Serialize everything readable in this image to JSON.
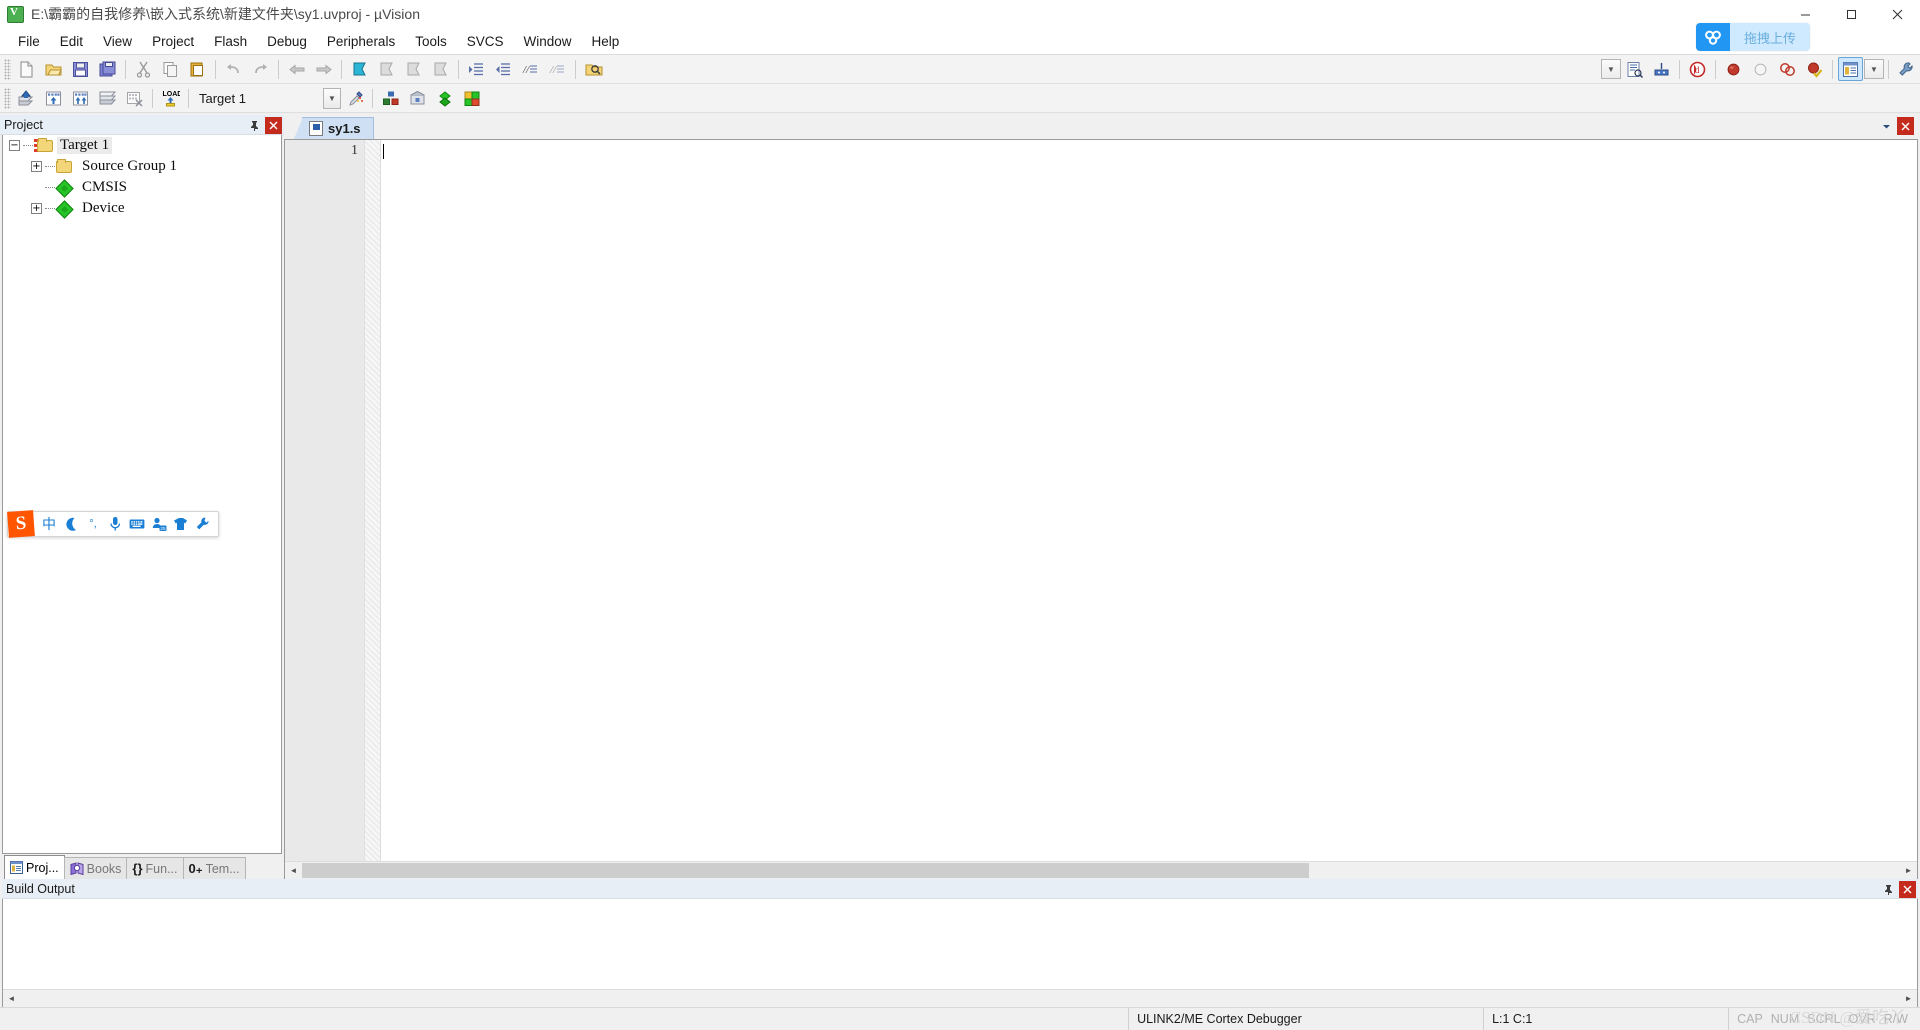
{
  "window": {
    "title": "E:\\霸霸的自我修养\\嵌入式系统\\新建文件夹\\sy1.uvproj - µVision",
    "app_icon": "uvision-icon",
    "minimize": "–",
    "maximize": "☐",
    "close": "✕"
  },
  "menu": {
    "items": [
      {
        "label": "File",
        "name": "menu-file"
      },
      {
        "label": "Edit",
        "name": "menu-edit"
      },
      {
        "label": "View",
        "name": "menu-view"
      },
      {
        "label": "Project",
        "name": "menu-project"
      },
      {
        "label": "Flash",
        "name": "menu-flash"
      },
      {
        "label": "Debug",
        "name": "menu-debug"
      },
      {
        "label": "Peripherals",
        "name": "menu-peripherals"
      },
      {
        "label": "Tools",
        "name": "menu-tools"
      },
      {
        "label": "SVCS",
        "name": "menu-svcs"
      },
      {
        "label": "Window",
        "name": "menu-window"
      },
      {
        "label": "Help",
        "name": "menu-help"
      }
    ]
  },
  "upload_widget": {
    "label": "拖拽上传",
    "icon": "baidu-netdisk-icon",
    "icon_color": "#2196f3",
    "label_bg": "#cfeaff",
    "label_color": "#6aaede"
  },
  "toolbar_file": {
    "buttons": [
      "new-file-icon",
      "open-file-icon",
      "save-icon",
      "save-all-icon",
      "cut-icon",
      "copy-icon",
      "paste-icon",
      "undo-icon",
      "redo-icon",
      "navigate-back-icon",
      "navigate-forward-icon",
      "bookmark-toggle-icon",
      "bookmark-prev-icon",
      "bookmark-next-icon",
      "bookmark-clear-icon",
      "indent-icon",
      "outdent-icon",
      "comment-icon",
      "uncomment-icon",
      "find-in-files-icon"
    ],
    "combo_value": "",
    "right_buttons": [
      "configure-target-icon",
      "debug-settings-icon",
      "start-debug-icon",
      "insert-breakpoint-icon",
      "disable-breakpoint-icon",
      "kill-all-breakpoints-icon",
      "disable-all-breakpoints-icon",
      "window-layout-icon",
      "configure-icon"
    ]
  },
  "toolbar_build": {
    "buttons": [
      "translate-icon",
      "build-icon",
      "rebuild-icon",
      "batch-build-icon",
      "stop-build-icon",
      "load-icon"
    ],
    "target_select": {
      "value": "Target 1",
      "name": "target-select"
    },
    "right_buttons": [
      "target-options-icon",
      "manage-components-icon",
      "pack-installer-icon",
      "manage-run-time-env-icon",
      "select-software-packs-icon"
    ]
  },
  "project_pane": {
    "title": "Project",
    "pin": "📌",
    "close": "✕",
    "tree": [
      {
        "label": "Target 1",
        "icon": "target-folder-icon",
        "expander": "−",
        "level": 0,
        "selected": true
      },
      {
        "label": "Source Group 1",
        "icon": "folder-icon",
        "expander": "+",
        "level": 1,
        "selected": false
      },
      {
        "label": "CMSIS",
        "icon": "component-icon",
        "expander": "",
        "level": 1,
        "selected": false
      },
      {
        "label": "Device",
        "icon": "component-icon",
        "expander": "+",
        "level": 1,
        "selected": false
      }
    ],
    "tabs": [
      {
        "label": "Proj...",
        "icon": "project-icon",
        "active": true
      },
      {
        "label": "Books",
        "icon": "books-icon",
        "active": false
      },
      {
        "label": "Fun...",
        "icon": "functions-icon",
        "active": false
      },
      {
        "label": "Tem...",
        "icon": "templates-icon",
        "active": false
      }
    ]
  },
  "ime_bar": {
    "logo": "S",
    "items": [
      {
        "glyph": "中",
        "name": "ime-mode-chinese"
      },
      {
        "glyph": "☾",
        "name": "ime-moon-icon"
      },
      {
        "glyph": "°,",
        "name": "ime-punctuation-icon"
      },
      {
        "glyph": "🎤",
        "name": "ime-voice-icon"
      },
      {
        "glyph": "⌨",
        "name": "ime-keyboard-icon"
      },
      {
        "glyph": "☰",
        "name": "ime-toolbox-icon"
      },
      {
        "glyph": "👕",
        "name": "ime-skin-icon"
      },
      {
        "glyph": "🔧",
        "name": "ime-settings-icon"
      }
    ]
  },
  "editor": {
    "tab": {
      "label": "sy1.s",
      "icon": "asm-file-icon"
    },
    "pin": "▾",
    "close": "✕",
    "line_numbers": [
      "1"
    ],
    "content": "",
    "hscroll": {
      "left_arrow": "◄",
      "right_arrow": "►"
    }
  },
  "build_output": {
    "title": "Build Output",
    "pin": "📌",
    "close": "✕",
    "content": "",
    "hscroll": {
      "left_arrow": "◄",
      "right_arrow": "►"
    }
  },
  "status_bar": {
    "message": "",
    "debugger": "ULINK2/ME Cortex Debugger",
    "cursor": "L:1 C:1",
    "flags": [
      "CAP",
      "NUM",
      "SCRL",
      "OVR",
      "R/W"
    ],
    "watermark": "CSDN @爱吃丫"
  }
}
